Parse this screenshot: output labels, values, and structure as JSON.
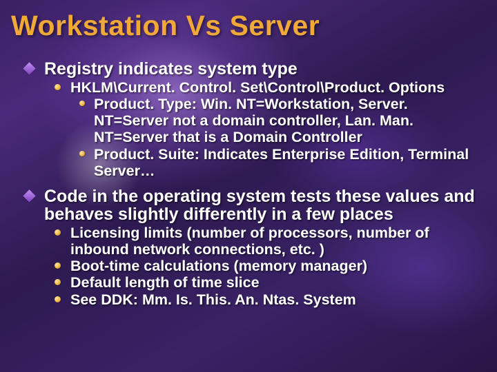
{
  "title": "Workstation Vs Server",
  "points": [
    {
      "text": "Registry indicates system type",
      "sub": [
        {
          "text": "HKLM\\Current. Control. Set\\Control\\Product. Options",
          "sub": [
            {
              "text": "Product. Type:  Win. NT=Workstation, Server. NT=Server not a domain controller, Lan. Man. NT=Server that is a Domain Controller"
            },
            {
              "text": "Product. Suite:  Indicates Enterprise Edition, Terminal Server…"
            }
          ]
        }
      ]
    },
    {
      "text": "Code in the operating system tests these values and behaves slightly differently in a few places",
      "sub": [
        {
          "text": "Licensing limits (number of processors, number of inbound network connections, etc. )"
        },
        {
          "text": "Boot-time calculations (memory manager)"
        },
        {
          "text": "Default length of time slice"
        },
        {
          "text": "See DDK:  Mm. Is. This. An. Ntas. System"
        }
      ]
    }
  ]
}
